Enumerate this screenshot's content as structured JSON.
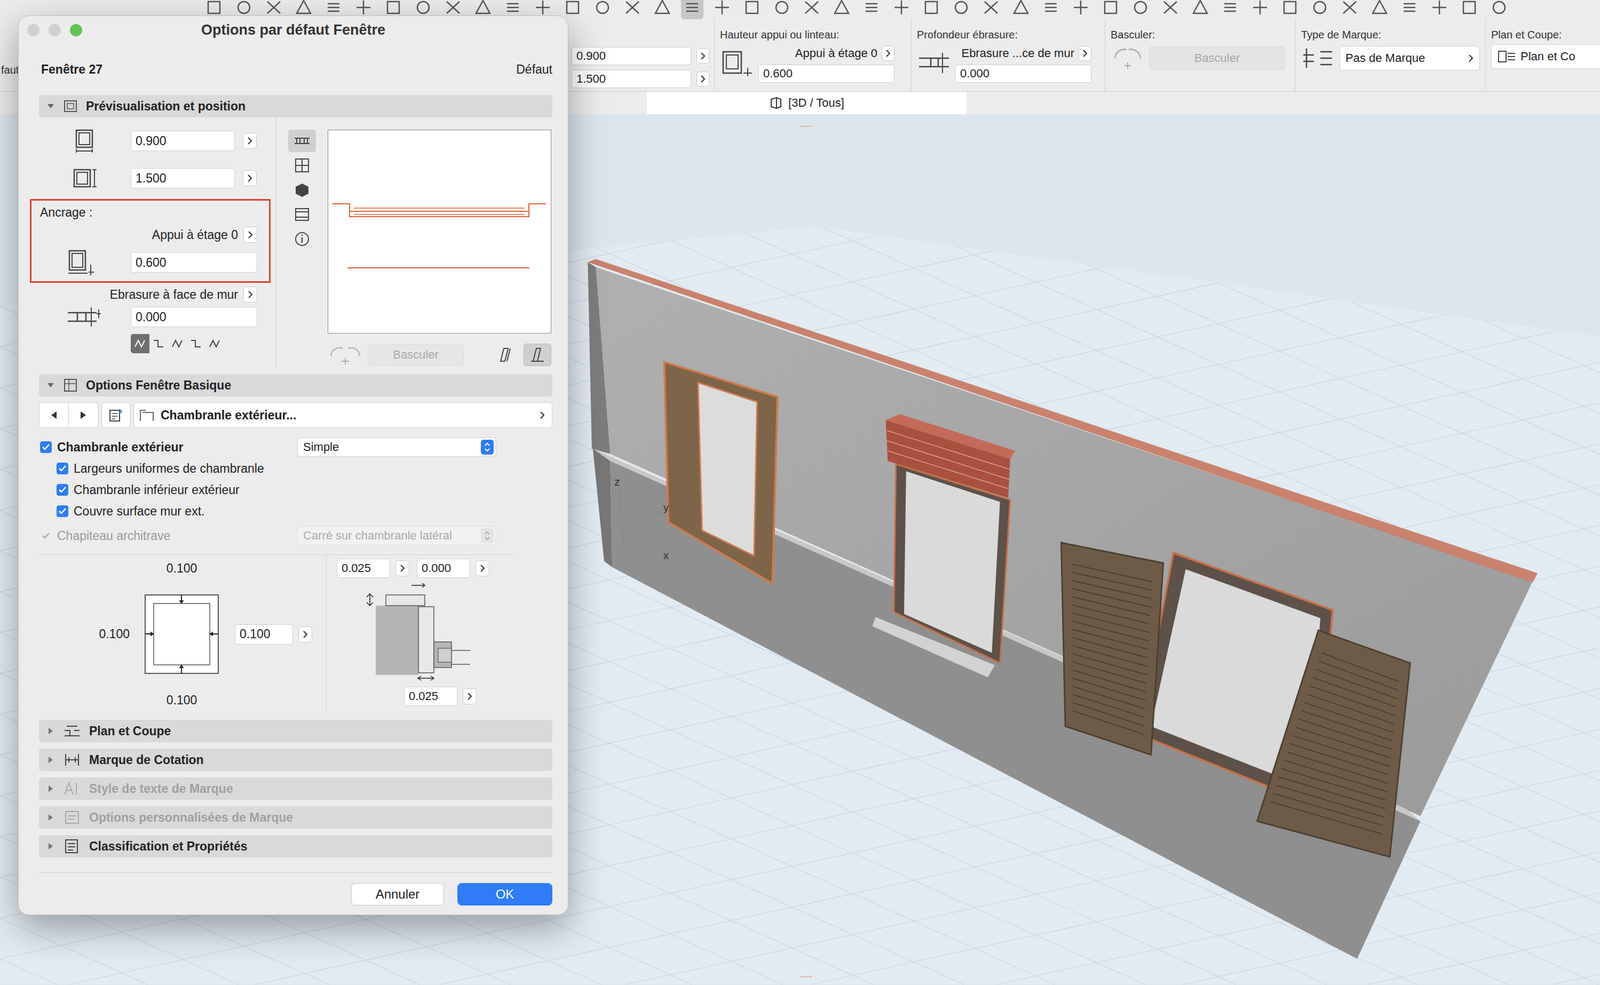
{
  "app": {
    "toolbar": {
      "tools": [
        {
          "selected": false
        },
        {
          "selected": false
        },
        {
          "selected": false
        },
        {
          "selected": false
        },
        {
          "selected": false
        },
        {
          "selected": false
        },
        {
          "selected": false
        },
        {
          "selected": false
        },
        {
          "selected": false
        },
        {
          "selected": false
        },
        {
          "selected": false
        },
        {
          "selected": false
        },
        {
          "selected": false
        },
        {
          "selected": false
        },
        {
          "selected": false
        },
        {
          "selected": false
        },
        {
          "selected": true
        },
        {
          "selected": false
        },
        {
          "selected": false
        },
        {
          "selected": false
        },
        {
          "selected": false
        },
        {
          "selected": false
        },
        {
          "selected": false
        },
        {
          "selected": false
        },
        {
          "selected": false
        },
        {
          "selected": false
        },
        {
          "selected": false
        },
        {
          "selected": false
        },
        {
          "selected": false
        },
        {
          "selected": false
        },
        {
          "selected": false
        },
        {
          "selected": false
        },
        {
          "selected": false
        },
        {
          "selected": false
        },
        {
          "selected": false
        },
        {
          "selected": false
        },
        {
          "selected": false
        },
        {
          "selected": false
        },
        {
          "selected": false
        },
        {
          "selected": false
        },
        {
          "selected": false
        },
        {
          "selected": false
        },
        {
          "selected": false
        },
        {
          "selected": false
        }
      ]
    },
    "info_box": {
      "edge_text": "faut",
      "width_field": "0.900",
      "height_field": "1.500",
      "groups": [
        {
          "label": "Hauteur appui ou linteau:",
          "kind": "anchor",
          "value": "Appui à étage 0",
          "field": "0.600",
          "disabled": false
        },
        {
          "label": "Profondeur ébrasure:",
          "kind": "anchor",
          "value": "Ebrasure ...ce de mur",
          "field": "0.000",
          "disabled": false
        },
        {
          "label": "Basculer:",
          "kind": "button",
          "value": "Basculer",
          "field": "",
          "disabled": true
        },
        {
          "label": "Type de Marque:",
          "kind": "dropdown",
          "value": "Pas de Marque",
          "field": "",
          "disabled": false
        },
        {
          "label": "Plan et Coupe:",
          "kind": "menu",
          "value": "Plan et Co",
          "field": "",
          "disabled": false
        }
      ]
    },
    "view_tab": {
      "label": "[3D / Tous]",
      "selected": true
    },
    "viewport": {
      "axes": [
        "z",
        "y",
        "x"
      ],
      "markers": [
        "----",
        "----"
      ]
    }
  },
  "dialog": {
    "title": "Options par défaut Fenêtre",
    "traffic_lights": [
      {
        "active": false
      },
      {
        "active": false
      },
      {
        "active": true
      }
    ],
    "element": "Fenêtre 27",
    "default_label": "Défaut",
    "preview_section": {
      "title": "Prévisualisation et position",
      "expanded": true,
      "width": "0.900",
      "height": "1.500",
      "anchor": {
        "label": "Ancrage :",
        "mode": "Appui à étage 0",
        "value": "0.600",
        "highlighted": true
      },
      "reveal": {
        "mode": "Ebrasure à face de mur",
        "value": "0.000",
        "options": [
          {
            "selected": true
          },
          {
            "selected": false
          },
          {
            "selected": false
          },
          {
            "selected": false
          },
          {
            "selected": false
          }
        ]
      },
      "view_tabs": [
        {
          "selected": true
        },
        {
          "selected": false
        },
        {
          "selected": false
        },
        {
          "selected": false
        },
        {
          "selected": false
        }
      ],
      "flip_button": {
        "label": "Basculer",
        "disabled": true
      },
      "side_buttons": [
        {
          "selected": false
        },
        {
          "selected": true
        }
      ]
    },
    "basic_section": {
      "title": "Options Fenêtre Basique",
      "expanded": true,
      "page": "Chambranle extérieur...",
      "main_option": {
        "label": "Chambranle extérieur",
        "checked": true,
        "style": "Simple"
      },
      "sub_options": [
        {
          "label": "Largeurs uniformes de chambranle",
          "checked": true,
          "disabled": false
        },
        {
          "label": "Chambranle inférieur extérieur",
          "checked": true,
          "disabled": false
        },
        {
          "label": "Couvre surface mur ext.",
          "checked": true,
          "disabled": false
        }
      ],
      "capital": {
        "label": "Chapiteau architrave",
        "checked": true,
        "disabled": true,
        "style": "Carré sur chambranle latéral"
      },
      "trim_widths": {
        "top": "0.100",
        "left": "0.100",
        "right": "0.100",
        "bottom": "0.100"
      },
      "profile": {
        "thickness": "0.025",
        "offset": "0.000",
        "depth": "0.025"
      }
    },
    "collapsed_sections": [
      {
        "title": "Plan et Coupe",
        "disabled": false,
        "expanded": false
      },
      {
        "title": "Marque de Cotation",
        "disabled": false,
        "expanded": false
      },
      {
        "title": "Style de texte de Marque",
        "disabled": true,
        "expanded": false
      },
      {
        "title": "Options personnalisées de Marque",
        "disabled": true,
        "expanded": false
      },
      {
        "title": "Classification et Propriétés",
        "disabled": false,
        "expanded": false
      }
    ],
    "buttons": [
      {
        "label": "Annuler",
        "primary": false
      },
      {
        "label": "OK",
        "primary": true
      }
    ]
  }
}
